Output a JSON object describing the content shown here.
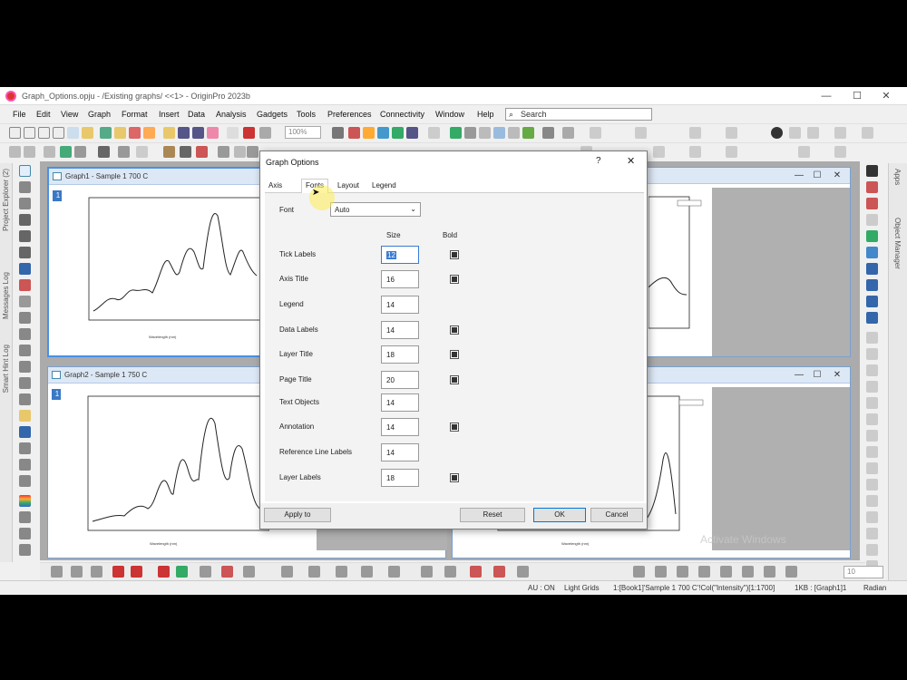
{
  "app": {
    "title": "Graph_Options.opju - /Existing graphs/ <<1> - OriginPro 2023b",
    "watermark": "Activate Windows"
  },
  "menubar": {
    "items": [
      "File",
      "Edit",
      "View",
      "Graph",
      "Format",
      "Insert",
      "Data",
      "Analysis",
      "Gadgets",
      "Tools",
      "Preferences",
      "Connectivity",
      "Window",
      "Help"
    ],
    "search_label": "Search"
  },
  "toolbar": {
    "zoom": "100%",
    "font_size": "10"
  },
  "side_panels": {
    "left": [
      "Project Explorer (2)",
      "Messages Log",
      "Smart Hint Log"
    ],
    "right": [
      "Apps",
      "Object Manager"
    ]
  },
  "graphs": [
    {
      "title": "Graph1 - Sample 1 700 C",
      "layer": "1"
    },
    {
      "title": "Graph2 - Sample 1 750 C",
      "layer": "1"
    }
  ],
  "dialog": {
    "title": "Graph Options",
    "help": "?",
    "close": "✕",
    "tabs": [
      "Axis",
      "Fonts",
      "Layout",
      "Legend"
    ],
    "active_tab": "Fonts",
    "font_label": "Font",
    "font_value": "Auto",
    "col_size": "Size",
    "col_bold": "Bold",
    "rows": [
      {
        "label": "Tick Labels",
        "size": "12",
        "bold": true,
        "has_bold": true
      },
      {
        "label": "Axis Title",
        "size": "16",
        "bold": true,
        "has_bold": true
      },
      {
        "label": "Legend",
        "size": "14",
        "bold": false,
        "has_bold": false
      },
      {
        "label": "Data Labels",
        "size": "14",
        "bold": true,
        "has_bold": true
      },
      {
        "label": "Layer Title",
        "size": "18",
        "bold": true,
        "has_bold": true
      },
      {
        "label": "Page Title",
        "size": "20",
        "bold": true,
        "has_bold": true
      },
      {
        "label": "Text Objects",
        "size": "14",
        "bold": false,
        "has_bold": false
      },
      {
        "label": "Annotation",
        "size": "14",
        "bold": true,
        "has_bold": true
      },
      {
        "label": "Reference Line Labels",
        "size": "14",
        "bold": false,
        "has_bold": false
      },
      {
        "label": "Layer Labels",
        "size": "18",
        "bold": true,
        "has_bold": true
      }
    ],
    "buttons": {
      "apply": "Apply to",
      "reset": "Reset",
      "ok": "OK",
      "cancel": "Cancel"
    }
  },
  "statusbar": {
    "au": "AU : ON",
    "theme": "Light Grids",
    "data": "1:[Book1]'Sample 1 700 C'!Col(\"Intensity\")[1:1700]",
    "size": "1KB : [Graph1]1",
    "units": "Radian"
  }
}
